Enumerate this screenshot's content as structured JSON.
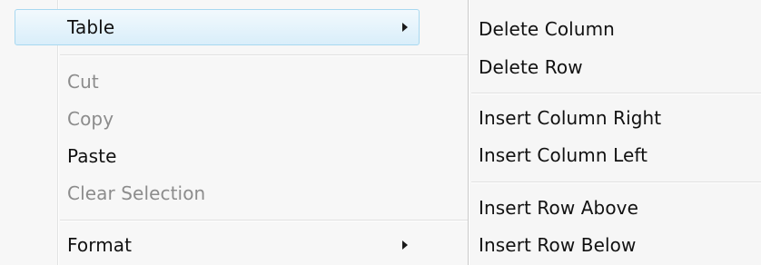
{
  "context_menu": {
    "items": [
      {
        "label": "Table",
        "has_submenu": true,
        "highlighted": true,
        "enabled": true
      },
      {
        "label": "Cut",
        "enabled": false
      },
      {
        "label": "Copy",
        "enabled": false
      },
      {
        "label": "Paste",
        "enabled": true
      },
      {
        "label": "Clear Selection",
        "enabled": false
      },
      {
        "label": "Format",
        "has_submenu": true,
        "enabled": true
      }
    ]
  },
  "table_submenu": {
    "items": [
      {
        "label": "Delete Column"
      },
      {
        "label": "Delete Row"
      },
      {
        "label": "Insert Column Right"
      },
      {
        "label": "Insert Column Left"
      },
      {
        "label": "Insert Row Above"
      },
      {
        "label": "Insert Row Below"
      }
    ]
  },
  "colors": {
    "highlight_border": "#a8d8f0",
    "highlight_fill": "#d9eefa",
    "disabled_text": "#8c8c8c",
    "menu_background": "#f7f7f7"
  }
}
